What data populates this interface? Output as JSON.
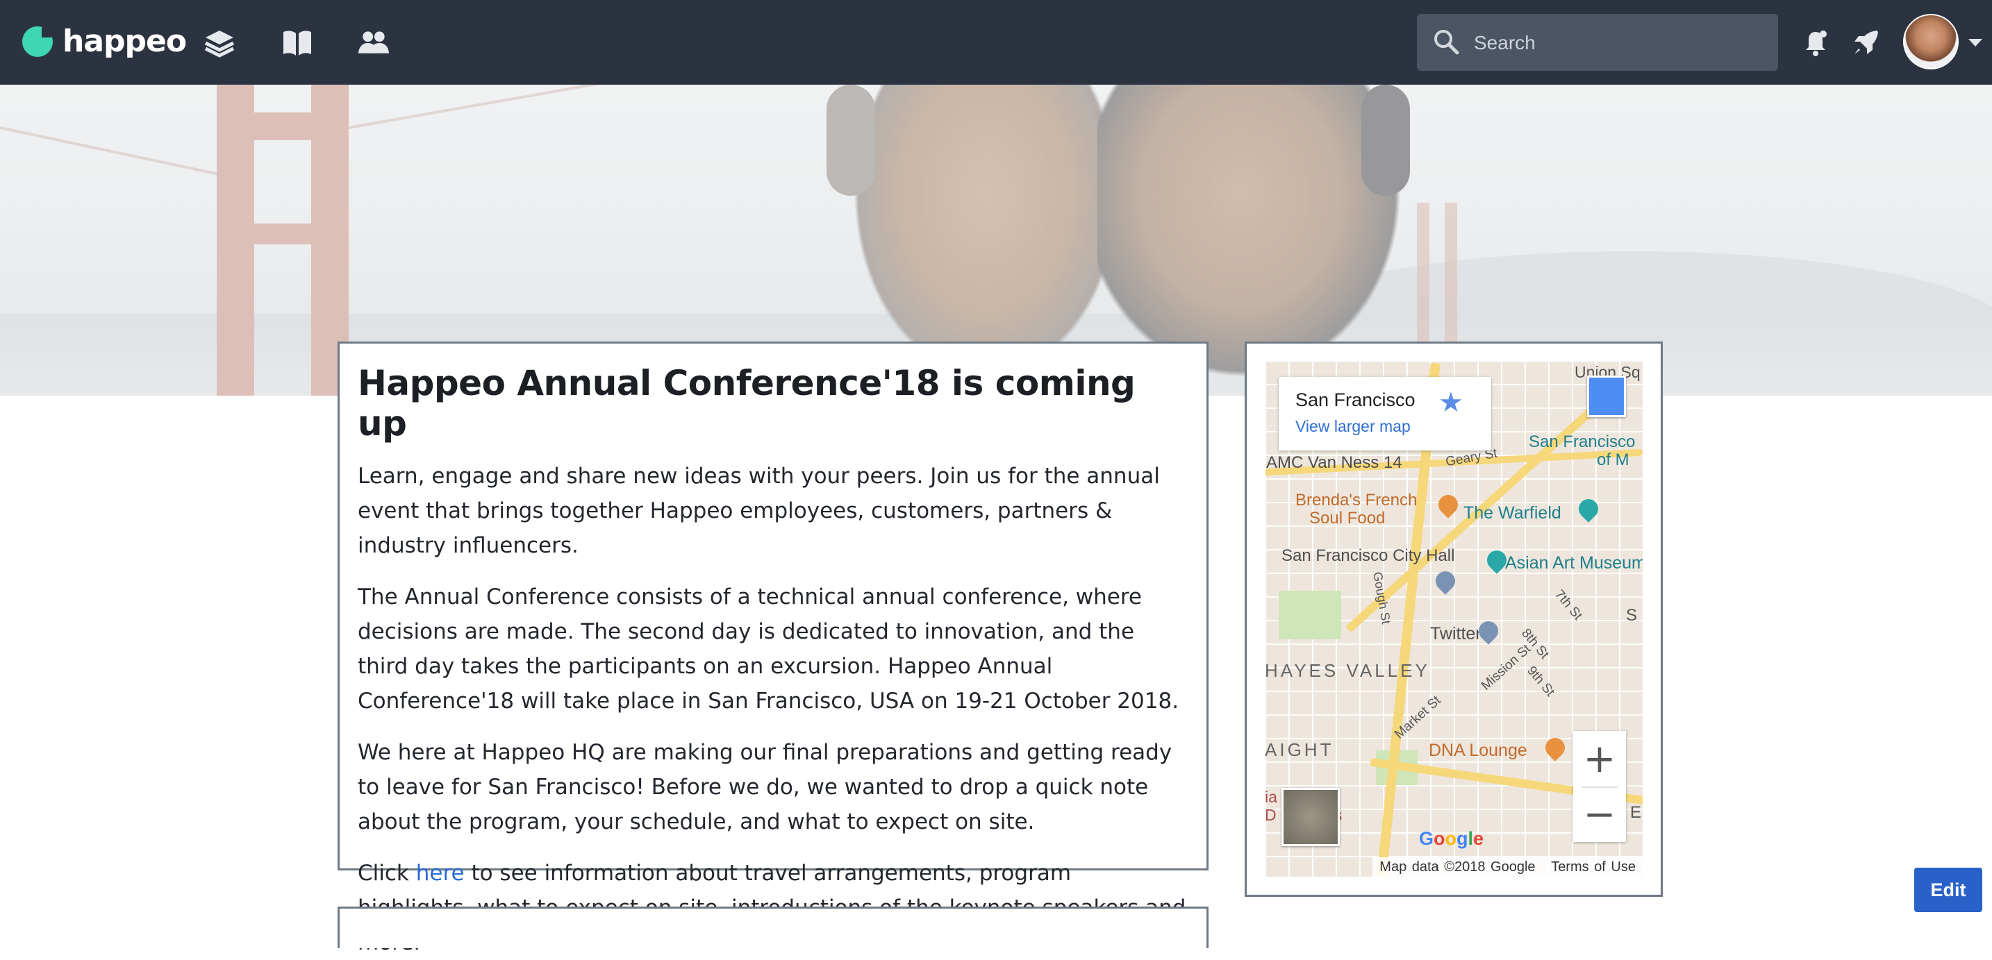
{
  "brand": {
    "name": "happeo"
  },
  "nav": {
    "icons": [
      "layers-icon",
      "book-icon",
      "people-icon"
    ]
  },
  "search": {
    "placeholder": "Search"
  },
  "toolbar": {
    "icons": [
      "notifications-icon",
      "rocket-icon"
    ]
  },
  "article": {
    "title": "Happeo Annual Conference'18 is coming up",
    "p1": "Learn, engage and share new ideas with your peers. Join us for the annual event that brings together Happeo employees, customers, partners & industry influencers.",
    "p2": "The Annual Conference consists of a technical annual conference, where decisions are made. The second day is dedicated to innovation, and the third day takes the participants on an excursion. Happeo Annual Conference'18 will take place in San Francisco, USA on 19-21 October 2018.",
    "p3": "We here at Happeo HQ are making our final preparations and getting ready to leave for San Francisco! Before we do, we wanted to drop a quick note about the program, your schedule, and what to expect on site.",
    "p4_before": "Click ",
    "p4_link": "here",
    "p4_after": " to see information about travel arrangements, program highlights, what to expect on site, introductions of the keynote speakers and more."
  },
  "map": {
    "place": "San Francisco",
    "view_larger": "View larger map",
    "labels": {
      "union": "Union Sq",
      "sf_top": "San Francisco",
      "of_m": "of M",
      "amc": "AMC Van Ness 14",
      "geary": "Geary St",
      "brendas1": "Brenda's French",
      "brendas2": "Soul Food",
      "warfield": "The Warfield",
      "city_hall": "San Francisco City Hall",
      "asian_art": "Asian Art Museum",
      "gough": "Gough St",
      "seventh": "7th St",
      "twitter": "Twitter",
      "eighth": "8th St",
      "hayes": "HAYES VALLEY",
      "mission": "Mission St",
      "ninth": "9th St",
      "market": "Market St",
      "haight": "AIGHT",
      "dna": "DNA Lounge",
      "medical1": "ia Medical",
      "medical2": "D    ampus",
      "s_label": "S",
      "e_label": "E"
    },
    "zoom_in": "+",
    "zoom_out": "−",
    "google": "Google",
    "attribution_data": "Map data ©2018 Google",
    "attribution_terms": "Terms of Use"
  },
  "edit_button": "Edit",
  "colors": {
    "topbar": "#2b3340",
    "accent": "#3fd6b4",
    "link": "#2d6bd4",
    "button": "#2961c9"
  }
}
